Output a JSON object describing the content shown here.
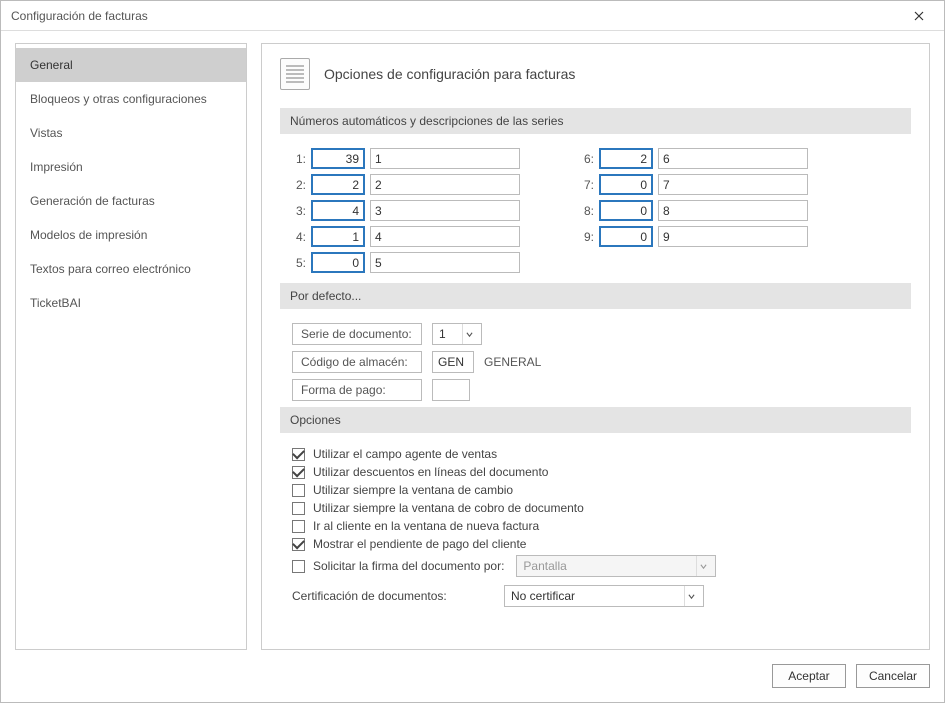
{
  "window": {
    "title": "Configuración de facturas"
  },
  "sidebar": {
    "items": [
      {
        "label": "General",
        "selected": true
      },
      {
        "label": "Bloqueos y otras configuraciones"
      },
      {
        "label": "Vistas"
      },
      {
        "label": "Impresión"
      },
      {
        "label": "Generación de facturas"
      },
      {
        "label": "Modelos de impresión"
      },
      {
        "label": "Textos para correo electrónico"
      },
      {
        "label": "TicketBAI"
      }
    ]
  },
  "main": {
    "heading": "Opciones de configuración para facturas",
    "sections": {
      "series": {
        "title": "Números automáticos y descripciones de las series",
        "rows": [
          {
            "idx": "1:",
            "num": "39",
            "desc": "1"
          },
          {
            "idx": "2:",
            "num": "2",
            "desc": "2"
          },
          {
            "idx": "3:",
            "num": "4",
            "desc": "3"
          },
          {
            "idx": "4:",
            "num": "1",
            "desc": "4"
          },
          {
            "idx": "5:",
            "num": "0",
            "desc": "5"
          },
          {
            "idx": "6:",
            "num": "2",
            "desc": "6"
          },
          {
            "idx": "7:",
            "num": "0",
            "desc": "7"
          },
          {
            "idx": "8:",
            "num": "0",
            "desc": "8"
          },
          {
            "idx": "9:",
            "num": "0",
            "desc": "9"
          }
        ]
      },
      "defaults": {
        "title": "Por defecto...",
        "serie_label": "Serie de documento:",
        "serie_value": "1",
        "almacen_label": "Código de almacén:",
        "almacen_value": "GEN",
        "almacen_extra": "GENERAL",
        "pago_label": "Forma de pago:",
        "pago_value": ""
      },
      "options": {
        "title": "Opciones",
        "items": [
          {
            "label": "Utilizar el campo agente de ventas",
            "checked": true
          },
          {
            "label": "Utilizar descuentos en líneas del documento",
            "checked": true
          },
          {
            "label": "Utilizar siempre la ventana de cambio",
            "checked": false
          },
          {
            "label": "Utilizar siempre la ventana de cobro de documento",
            "checked": false
          },
          {
            "label": "Ir al cliente en la ventana de nueva factura",
            "checked": false
          },
          {
            "label": "Mostrar el pendiente de pago del cliente",
            "checked": true
          }
        ],
        "firma_checked": false,
        "firma_label": "Solicitar la firma del documento por:",
        "firma_value": "Pantalla",
        "cert_label": "Certificación de documentos:",
        "cert_value": "No certificar"
      }
    }
  },
  "footer": {
    "accept": "Aceptar",
    "cancel": "Cancelar"
  }
}
